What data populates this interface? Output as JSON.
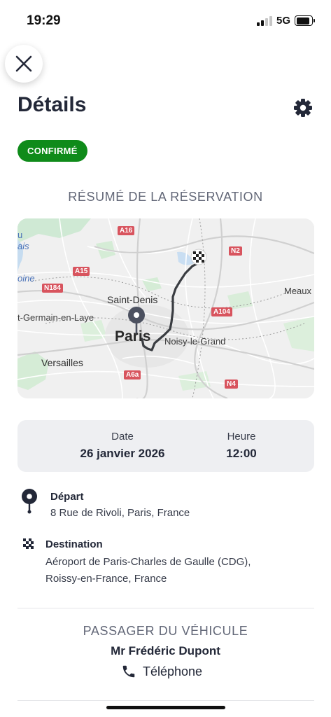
{
  "status_bar": {
    "time": "19:29",
    "network": "5G",
    "signal_bars_active": 2,
    "signal_bars_total": 4
  },
  "header": {
    "title": "Détails",
    "close_icon": "close-icon",
    "settings_icon": "gear-icon"
  },
  "status_badge": {
    "label": "CONFIRMÉ",
    "color": "#0f8b1a"
  },
  "summary": {
    "title": "RÉSUMÉ DE LA RÉSERVATION"
  },
  "map": {
    "road_labels": [
      "A16",
      "N2",
      "A15",
      "N184",
      "A104",
      "A6a",
      "N4"
    ],
    "places": {
      "saint_denis": "Saint-Denis",
      "germain": "t-Germain-en-Laye",
      "paris": "Paris",
      "noisy": "Noisy-le-Grand",
      "versailles": "Versailles",
      "meaux": "Meaux",
      "edge_a": "u",
      "edge_b": "ais",
      "edge_c": "oine"
    },
    "start_marker": "map-pin-icon",
    "end_marker": "checkered-flag-icon"
  },
  "booking": {
    "date_label": "Date",
    "date_value": "26 janvier 2026",
    "time_label": "Heure",
    "time_value": "12:00"
  },
  "departure": {
    "label": "Départ",
    "address": "8 Rue de Rivoli, Paris, France",
    "icon": "map-pin-icon"
  },
  "destination": {
    "label": "Destination",
    "address_line1": "Aéroport de Paris-Charles de Gaulle (CDG),",
    "address_line2": "Roissy-en-France, France",
    "icon": "checkered-flag-icon"
  },
  "passenger": {
    "section_title": "PASSAGER DU VÉHICULE",
    "name": "Mr Frédéric Dupont",
    "phone_label": "Téléphone",
    "phone_icon": "phone-icon"
  }
}
